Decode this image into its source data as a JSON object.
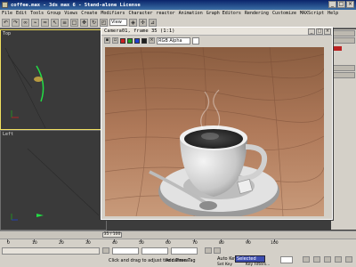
{
  "window": {
    "title": "coffee.max - 3ds max 6 - Stand-alone License",
    "controls": [
      "_",
      "□",
      "×"
    ]
  },
  "menu": [
    "File",
    "Edit",
    "Tools",
    "Group",
    "Views",
    "Create",
    "Modifiers",
    "Character",
    "reactor",
    "Animation",
    "Graph Editors",
    "Rendering",
    "Customize",
    "MAXScript",
    "Help"
  ],
  "toolbar": {
    "view_select": "View"
  },
  "viewports": {
    "top_label": "Top",
    "left_label": "Left"
  },
  "render_window": {
    "title": "Camera01, frame 35 (1:1)",
    "channel_select": "RGB Alpha",
    "swatch_colors": [
      "#cc2020",
      "#20a020",
      "#2040d0",
      "#202020"
    ],
    "controls": [
      "_",
      "□",
      "×"
    ]
  },
  "timeline": {
    "frame_indicator": "35 / 100",
    "ticks": [
      "0",
      "10",
      "20",
      "30",
      "40",
      "50",
      "60",
      "70",
      "80",
      "90",
      "100"
    ]
  },
  "status": {
    "prompt": "Click and drag to adjust the camera",
    "add_time_tag": "Add Time Tag",
    "auto_key": "Auto Key",
    "auto_key_mode": "Selected",
    "set_key": "Set Key",
    "key_filters": "Key Filters..."
  }
}
